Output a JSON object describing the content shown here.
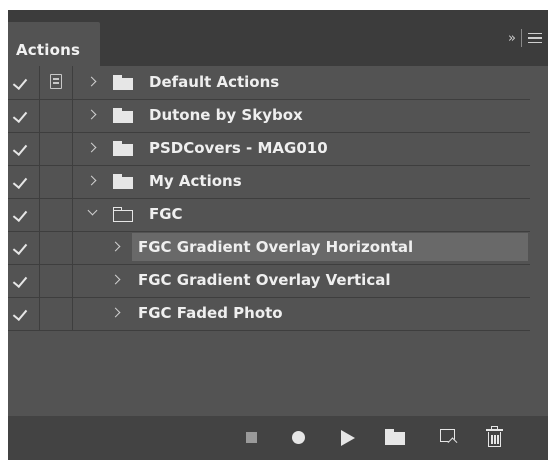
{
  "panel": {
    "tab_label": "Actions",
    "collapse_glyph": "»",
    "menu_icon": "hamburger-menu-icon"
  },
  "rows": [
    {
      "type": "set",
      "label": "Default Actions",
      "checked": true,
      "dialog": true,
      "expanded": false
    },
    {
      "type": "set",
      "label": "Dutone by Skybox",
      "checked": true,
      "dialog": false,
      "expanded": false
    },
    {
      "type": "set",
      "label": "PSDCovers - MAG010",
      "checked": true,
      "dialog": false,
      "expanded": false
    },
    {
      "type": "set",
      "label": "My Actions",
      "checked": true,
      "dialog": false,
      "expanded": false
    },
    {
      "type": "set",
      "label": "FGC",
      "checked": true,
      "dialog": false,
      "expanded": true
    },
    {
      "type": "action",
      "label": "FGC Gradient Overlay Horizontal",
      "checked": true,
      "dialog": false,
      "expanded": false,
      "selected": true
    },
    {
      "type": "action",
      "label": "FGC Gradient Overlay Vertical",
      "checked": true,
      "dialog": false,
      "expanded": false
    },
    {
      "type": "action",
      "label": "FGC Faded Photo",
      "checked": true,
      "dialog": false,
      "expanded": false
    }
  ],
  "toolbar": {
    "icons": [
      "stop-icon",
      "record-icon",
      "play-icon",
      "new-set-folder-icon",
      "new-action-icon",
      "delete-trash-icon"
    ]
  },
  "colors": {
    "panel_bg": "#535353",
    "tabbar_bg": "#3c3c3c",
    "bottombar_bg": "#434343",
    "selected_row": "#696969",
    "text": "#efefef"
  }
}
